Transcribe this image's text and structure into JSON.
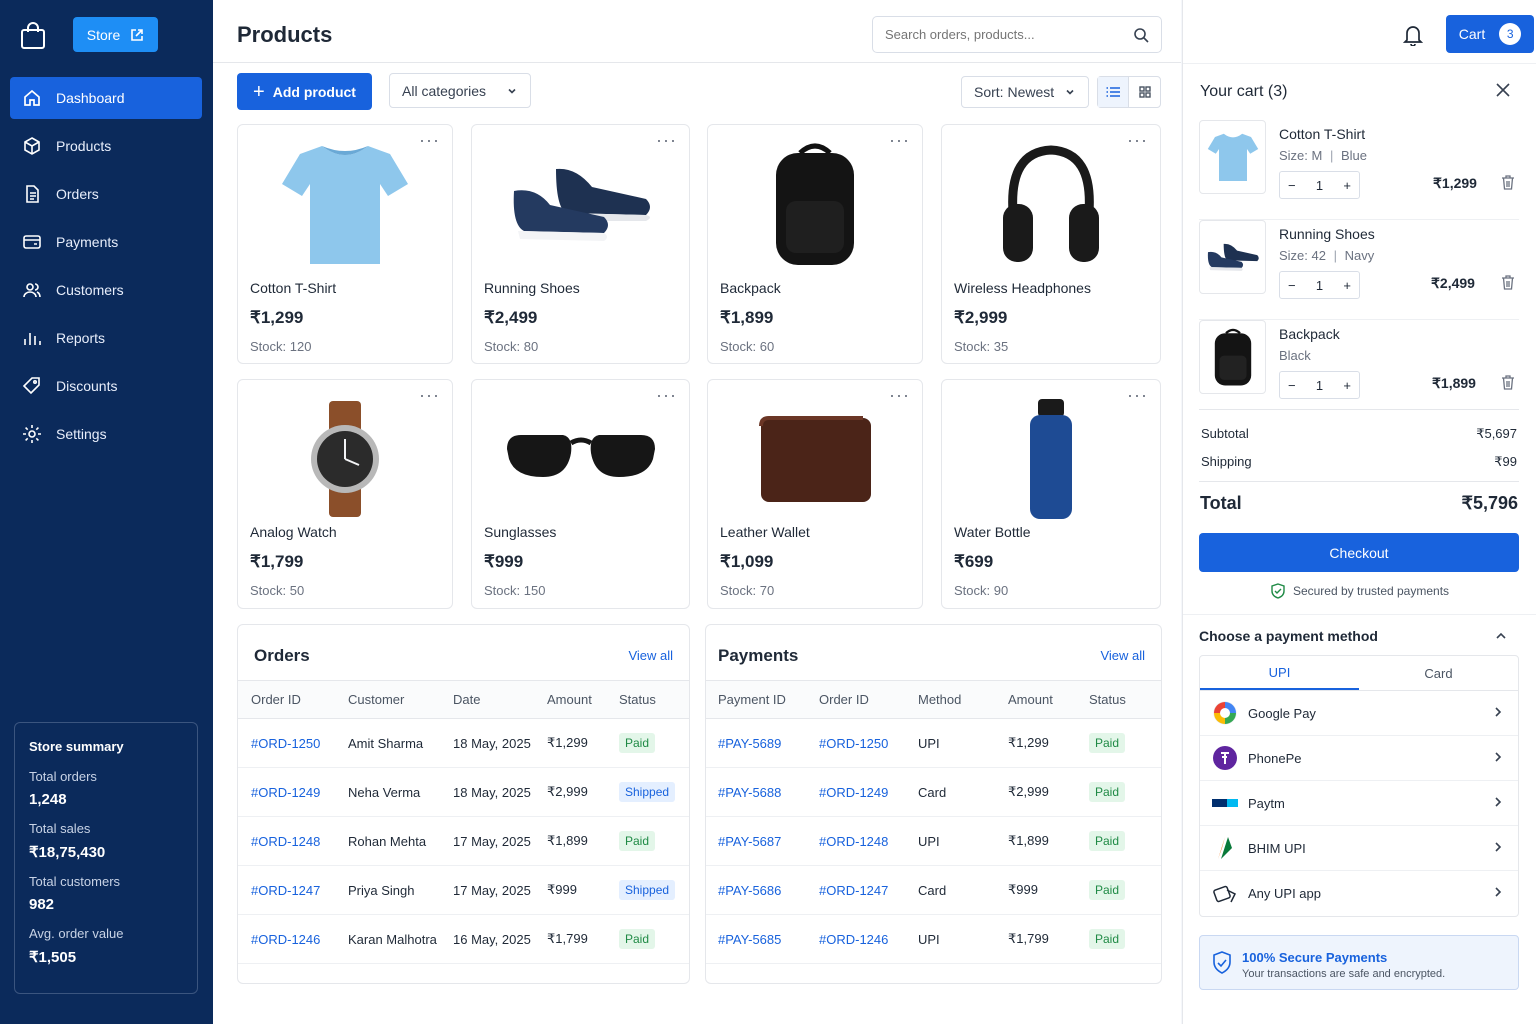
{
  "sidebar": {
    "store_label": "Store",
    "nav": [
      {
        "label": "Dashboard",
        "icon": "home-icon"
      },
      {
        "label": "Products",
        "icon": "cube-icon"
      },
      {
        "label": "Orders",
        "icon": "document-icon"
      },
      {
        "label": "Payments",
        "icon": "wallet-icon"
      },
      {
        "label": "Customers",
        "icon": "users-icon"
      },
      {
        "label": "Reports",
        "icon": "bar-chart-icon"
      },
      {
        "label": "Discounts",
        "icon": "tag-icon"
      },
      {
        "label": "Settings",
        "icon": "gear-icon"
      }
    ],
    "summary": {
      "title": "Store summary",
      "items": [
        {
          "label": "Total orders",
          "value": "1,248"
        },
        {
          "label": "Total sales",
          "value": "₹18,75,430"
        },
        {
          "label": "Total customers",
          "value": "982"
        },
        {
          "label": "Avg. order value",
          "value": "₹1,505"
        }
      ]
    }
  },
  "header": {
    "title": "Products",
    "search_placeholder": "Search orders, products..."
  },
  "toolbar": {
    "add_label": "Add product",
    "category": "All categories",
    "sort": "Sort: Newest"
  },
  "products": [
    {
      "name": "Cotton T-Shirt",
      "price": "₹1,299",
      "stock": "Stock: 120"
    },
    {
      "name": "Running Shoes",
      "price": "₹2,499",
      "stock": "Stock: 80"
    },
    {
      "name": "Backpack",
      "price": "₹1,899",
      "stock": "Stock: 60"
    },
    {
      "name": "Wireless Headphones",
      "price": "₹2,999",
      "stock": "Stock: 35"
    },
    {
      "name": "Analog Watch",
      "price": "₹1,799",
      "stock": "Stock: 50"
    },
    {
      "name": "Sunglasses",
      "price": "₹999",
      "stock": "Stock: 150"
    },
    {
      "name": "Leather Wallet",
      "price": "₹1,099",
      "stock": "Stock: 70"
    },
    {
      "name": "Water Bottle",
      "price": "₹699",
      "stock": "Stock: 90"
    }
  ],
  "orders": {
    "title": "Orders",
    "view_all": "View all",
    "columns": [
      "Order ID",
      "Customer",
      "Date",
      "Amount",
      "Status"
    ],
    "rows": [
      [
        "#ORD-1250",
        "Amit Sharma",
        "18 May, 2025",
        "₹1,299",
        "Paid"
      ],
      [
        "#ORD-1249",
        "Neha Verma",
        "18 May, 2025",
        "₹2,999",
        "Shipped"
      ],
      [
        "#ORD-1248",
        "Rohan Mehta",
        "17 May, 2025",
        "₹1,899",
        "Paid"
      ],
      [
        "#ORD-1247",
        "Priya Singh",
        "17 May, 2025",
        "₹999",
        "Shipped"
      ],
      [
        "#ORD-1246",
        "Karan Malhotra",
        "16 May, 2025",
        "₹1,799",
        "Paid"
      ]
    ]
  },
  "payments": {
    "title": "Payments",
    "view_all": "View all",
    "columns": [
      "Payment ID",
      "Order ID",
      "Method",
      "Amount",
      "Status"
    ],
    "rows": [
      [
        "#PAY-5689",
        "#ORD-1250",
        "UPI",
        "₹1,299",
        "Paid"
      ],
      [
        "#PAY-5688",
        "#ORD-1249",
        "Card",
        "₹2,999",
        "Paid"
      ],
      [
        "#PAY-5687",
        "#ORD-1248",
        "UPI",
        "₹1,899",
        "Paid"
      ],
      [
        "#PAY-5686",
        "#ORD-1247",
        "Card",
        "₹999",
        "Paid"
      ],
      [
        "#PAY-5685",
        "#ORD-1246",
        "UPI",
        "₹1,799",
        "Paid"
      ]
    ]
  },
  "cart": {
    "button_label": "Cart",
    "count": "3",
    "title": "Your cart (3)",
    "items": [
      {
        "name": "Cotton T-Shirt",
        "size": "Size: M",
        "color": "Blue",
        "qty": "1",
        "price": "₹1,299"
      },
      {
        "name": "Running Shoes",
        "size": "Size: 42",
        "color": "Navy",
        "qty": "1",
        "price": "₹2,499"
      },
      {
        "name": "Backpack",
        "size": "",
        "color": "Black",
        "qty": "1",
        "price": "₹1,899"
      }
    ],
    "subtotal_label": "Subtotal",
    "subtotal": "₹5,697",
    "shipping_label": "Shipping",
    "shipping": "₹99",
    "total_label": "Total",
    "total": "₹5,796",
    "checkout_label": "Checkout",
    "secured_text": "Secured by trusted payments",
    "payment": {
      "title": "Choose a payment method",
      "tabs": [
        "UPI",
        "Card"
      ],
      "methods": [
        "Google Pay",
        "PhonePe",
        "Paytm",
        "BHIM UPI",
        "Any UPI app"
      ]
    },
    "secure_title": "100% Secure Payments",
    "secure_sub": "Your transactions are safe and encrypted."
  },
  "colors": {
    "sidebar": "#0b2a5b",
    "accent": "#1862dd",
    "store_button": "#1e8ef5",
    "paid": "#1f8a45",
    "shipped": "#1862dd"
  }
}
